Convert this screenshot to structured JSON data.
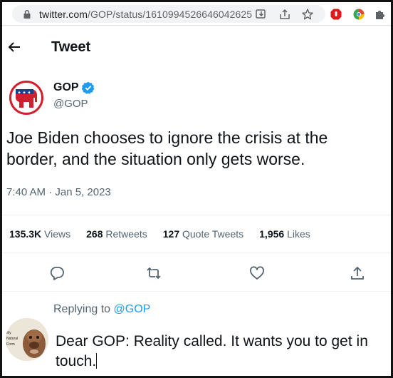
{
  "browser": {
    "url": "twitter.com/GOP/status/1610994526646042625",
    "url_host": "twitter.com",
    "url_path": "/GOP/status/1610994526646042625"
  },
  "header": {
    "title": "Tweet"
  },
  "tweet": {
    "display_name": "GOP",
    "handle": "@GOP",
    "text": "Joe Biden chooses to ignore the crisis at the border, and the situation only gets worse.",
    "timestamp": "7:40 AM · Jan 5, 2023",
    "stats": [
      {
        "value": "135.3K",
        "label": "Views"
      },
      {
        "value": "268",
        "label": "Retweets"
      },
      {
        "value": "127",
        "label": "Quote Tweets"
      },
      {
        "value": "1,956",
        "label": "Likes"
      }
    ]
  },
  "reply": {
    "replying_prefix": "Replying to",
    "replying_handle": "@GOP",
    "text": "Dear GOP: Reality called. It wants you to get in touch.",
    "avatar_caption": "My Natural Form"
  },
  "colors": {
    "brand_red": "#d21f2e",
    "link_blue": "#1d9bf0",
    "muted_text": "#536471",
    "verified_blue": "#1d9bf0"
  }
}
